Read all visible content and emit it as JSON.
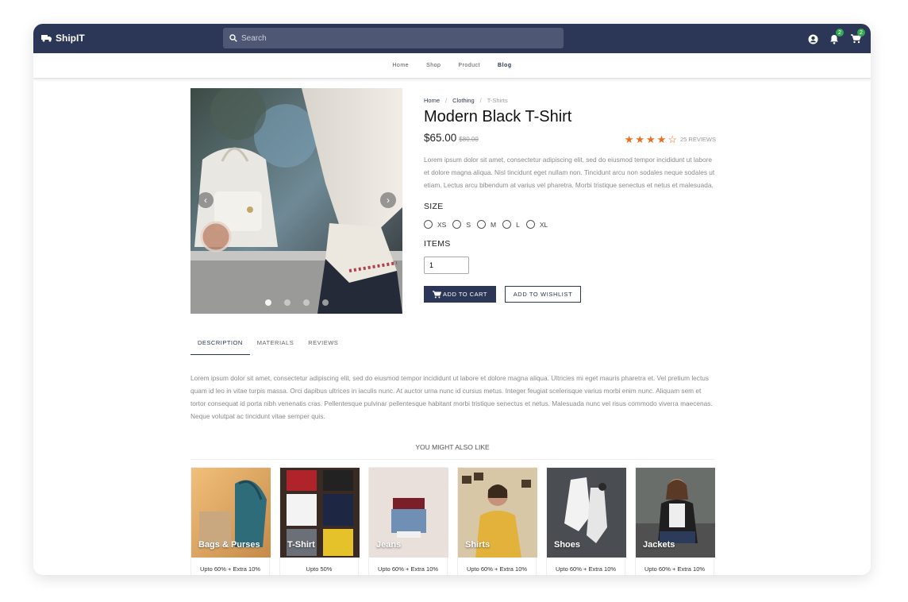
{
  "topbar": {
    "brand": "ShipIT",
    "search_placeholder": "Search",
    "notifications_count": "2",
    "cart_count": "2"
  },
  "nav": [
    {
      "label": "Home",
      "active": false
    },
    {
      "label": "Shop",
      "active": false
    },
    {
      "label": "Product",
      "active": false
    },
    {
      "label": "Blog",
      "active": true
    }
  ],
  "product": {
    "breadcrumb": [
      "Home",
      "Clothing",
      "T-Shirts"
    ],
    "title": "Modern Black T-Shirt",
    "price": "$65.00",
    "old_price": "$80.00",
    "rating": 4,
    "rating_max": 5,
    "reviews": "25 REVIEWS",
    "description": "Lorem ipsum dolor sit amet, consectetur adipiscing elit, sed do eiusmod tempor incididunt ut labore et dolore magna aliqua. Nisl tincidunt eget nullam non. Tincidunt arcu non sodales neque sodales ut etiam. Lectus arcu bibendum at varius vel pharetra. Morbi tristique senectus et netus et malesuada.",
    "size_label": "SIZE",
    "sizes": [
      "XS",
      "S",
      "M",
      "L",
      "XL"
    ],
    "items_label": "ITEMS",
    "quantity": "1",
    "add_to_cart": "ADD TO CART",
    "add_to_wishlist": "ADD TO WISHLIST",
    "gallery_slides": 4,
    "gallery_active": 1
  },
  "tabs": [
    {
      "label": "DESCRIPTION",
      "active": true
    },
    {
      "label": "MATERIALS",
      "active": false
    },
    {
      "label": "REVIEWS",
      "active": false
    }
  ],
  "long_description": "Lorem ipsum dolor sit amet, consectetur adipiscing elit, sed do eiusmod tempor incididunt ut labore et dolore magna aliqua. Ultricies mi eget mauris pharetra et. Vel pretium lectus quam id leo in vitae turpis massa. Orci dapibus ultrices in iaculis nunc. At auctor urna nunc id cursus metus. Integer feugiat scelerisque varius morbi enim nunc. Aliquam sem et tortor consequat id porta nibh venenatis cras. Pellentesque pulvinar pellentesque habitant morbi tristique senectus et netus. Malesuada nunc vel risus commodo viverra maecenas. Neque volutpat ac tincidunt vitae semper quis.",
  "recommendations": {
    "heading": "YOU MIGHT ALSO LIKE",
    "items": [
      {
        "name": "Bags & Purses",
        "offer": "Upto 60% + Extra 10%"
      },
      {
        "name": "T-Shirt",
        "offer": "Upto 50%"
      },
      {
        "name": "Jeans",
        "offer": "Upto 60% + Extra 10%"
      },
      {
        "name": "Shirts",
        "offer": "Upto 60% + Extra 10%"
      },
      {
        "name": "Shoes",
        "offer": "Upto 60% + Extra 10%"
      },
      {
        "name": "Jackets",
        "offer": "Upto 60% + Extra 10%"
      }
    ]
  },
  "colors": {
    "primary": "#2c3657",
    "accent_star": "#ef6c1a",
    "badge": "#33a853"
  }
}
